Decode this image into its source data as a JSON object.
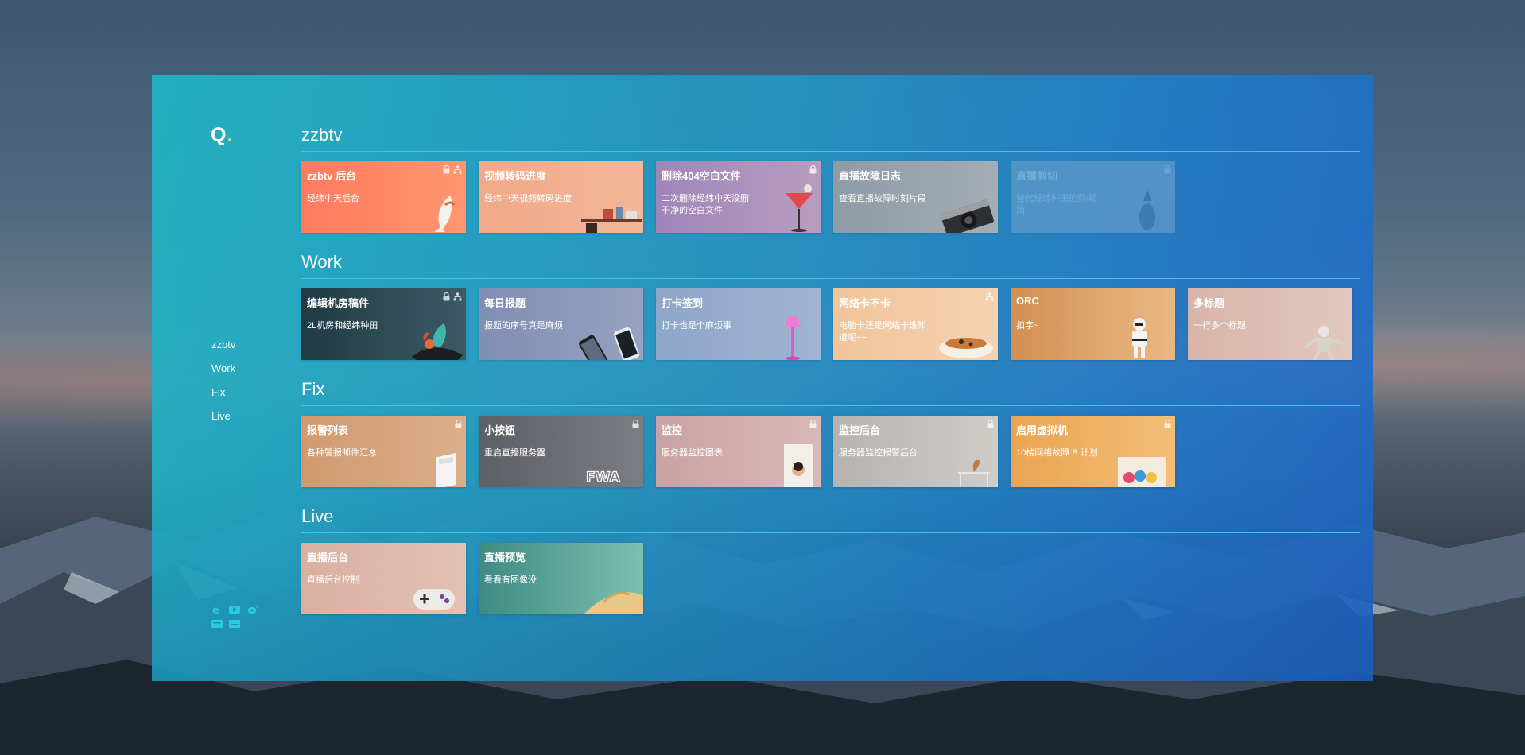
{
  "brand": {
    "logo_text": "Q",
    "logo_dot": "."
  },
  "sidebar": {
    "items": [
      "zzbtv",
      "Work",
      "Fix",
      "Live"
    ]
  },
  "social_icons": [
    "ie-icon",
    "youtube-icon",
    "weibo-icon",
    "card-icon",
    "card-icon-2"
  ],
  "sections": [
    {
      "title": "zzbtv",
      "cards": [
        {
          "title": "zzbtv 后台",
          "desc": "经纬中天后台",
          "lock": true,
          "share": true
        },
        {
          "title": "视频转码进度",
          "desc": "经纬中天视频转码进度",
          "lock": false,
          "share": false
        },
        {
          "title": "删除404空白文件",
          "desc": "二次删除经纬中天没删干净的空白文件",
          "lock": true,
          "share": false
        },
        {
          "title": "直播故障日志",
          "desc": "查看直播故障时刻片段",
          "lock": false,
          "share": false
        },
        {
          "title": "直播剪切",
          "desc": "替代经纬种田的剪/精简",
          "lock": true,
          "share": false
        }
      ]
    },
    {
      "title": "Work",
      "cards": [
        {
          "title": "编辑机房稿件",
          "desc": "2L机房和经纬种田",
          "lock": true,
          "share": true
        },
        {
          "title": "每日报题",
          "desc": "报题的序号真是麻烦",
          "lock": false,
          "share": false
        },
        {
          "title": "打卡签到",
          "desc": "打卡也是个麻烦事",
          "lock": false,
          "share": false
        },
        {
          "title": "网络卡不卡",
          "desc": "电脑卡还是网络卡谁知道呢~~",
          "lock": false,
          "share": true
        },
        {
          "title": "ORC",
          "desc": "扣字~",
          "lock": false,
          "share": false
        },
        {
          "title": "多标题",
          "desc": "一行多个标题",
          "lock": false,
          "share": false
        }
      ]
    },
    {
      "title": "Fix",
      "cards": [
        {
          "title": "报警列表",
          "desc": "各种警报邮件汇总",
          "lock": true,
          "share": false
        },
        {
          "title": "小按钮",
          "desc": "重启直播服务器",
          "lock": true,
          "share": false
        },
        {
          "title": "监控",
          "desc": "服务器监控图表",
          "lock": true,
          "share": false
        },
        {
          "title": "监控后台",
          "desc": "服务器监控报警后台",
          "lock": true,
          "share": false
        },
        {
          "title": "启用虚拟机",
          "desc": "10楼网络故障 B 计划",
          "lock": true,
          "share": false
        }
      ]
    },
    {
      "title": "Live",
      "cards": [
        {
          "title": "直播后台",
          "desc": "直播后台控制",
          "lock": false,
          "share": false
        },
        {
          "title": "直播预览",
          "desc": "看看有图像没",
          "lock": false,
          "share": false
        }
      ]
    }
  ],
  "art_text": {
    "fwa": "FWA"
  },
  "colors": {
    "panel_start": "#20b6c4",
    "panel_end": "#1e64c8",
    "rule": "#3fc5e8",
    "logo_dot": "#a8f07a"
  }
}
